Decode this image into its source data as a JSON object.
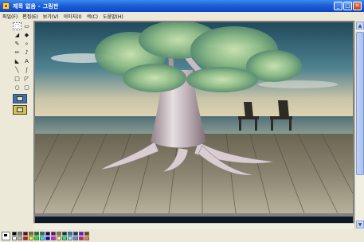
{
  "window": {
    "title": "제목 없음 - 그림판",
    "minimize": "_",
    "maximize": "□",
    "close": "×"
  },
  "menubar": {
    "items": [
      "파일(F)",
      "편집(E)",
      "보기(V)",
      "이미지(I)",
      "색(C)",
      "도움말(H)"
    ]
  },
  "toolbox": {
    "tools": [
      {
        "icon": "free-select-icon",
        "glyph": "⬚"
      },
      {
        "icon": "rect-select-icon",
        "glyph": "▭"
      },
      {
        "icon": "eraser-icon",
        "glyph": "◢"
      },
      {
        "icon": "fill-icon",
        "glyph": "◆"
      },
      {
        "icon": "color-picker-icon",
        "glyph": "✎"
      },
      {
        "icon": "magnifier-icon",
        "glyph": "⌕"
      },
      {
        "icon": "pencil-icon",
        "glyph": "✏"
      },
      {
        "icon": "brush-icon",
        "glyph": "♪"
      },
      {
        "icon": "airbrush-icon",
        "glyph": "◣"
      },
      {
        "icon": "text-icon",
        "glyph": "A"
      },
      {
        "icon": "line-icon",
        "glyph": "╲"
      },
      {
        "icon": "curve-icon",
        "glyph": "∫"
      },
      {
        "icon": "rectangle-icon",
        "glyph": "□"
      },
      {
        "icon": "polygon-icon",
        "glyph": "◸"
      },
      {
        "icon": "ellipse-icon",
        "glyph": "○"
      },
      {
        "icon": "rounded-rect-icon",
        "glyph": "▢"
      }
    ]
  },
  "palette": {
    "colors": [
      "#000000",
      "#808080",
      "#800000",
      "#808000",
      "#008000",
      "#008080",
      "#000080",
      "#800080",
      "#808040",
      "#004040",
      "#0080ff",
      "#004080",
      "#8000ff",
      "#804000",
      "#ffffff",
      "#c0c0c0",
      "#ff0000",
      "#ffff00",
      "#00ff00",
      "#00ffff",
      "#0000ff",
      "#ff00ff",
      "#ffff80",
      "#00ff80",
      "#80ffff",
      "#8080ff",
      "#ff0080",
      "#ff8040"
    ]
  }
}
